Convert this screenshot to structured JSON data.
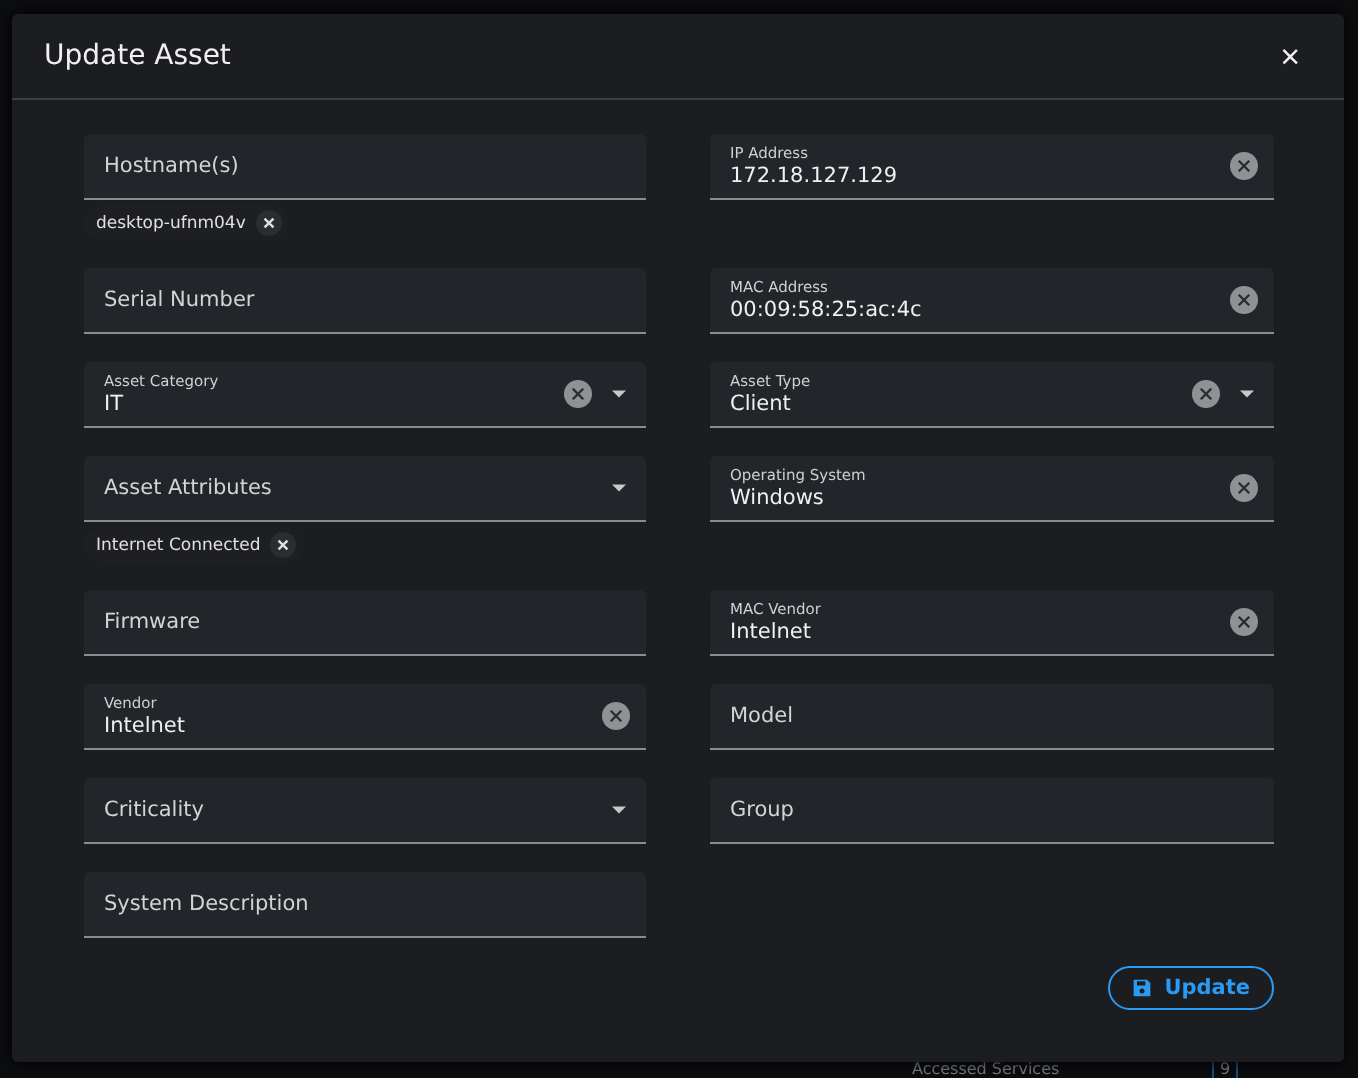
{
  "background": {
    "texts": [
      "Accessed Services",
      "9"
    ]
  },
  "dialog": {
    "title": "Update Asset",
    "close_symbol": "×"
  },
  "rows": [
    {
      "left": {
        "label": "Hostname(s)",
        "clearable": false,
        "dropdown": false,
        "chips": [
          "desktop-ufnm04v"
        ]
      },
      "right": {
        "label": "IP Address",
        "value": "172.18.127.129",
        "clearable": true,
        "dropdown": false
      }
    },
    {
      "left": {
        "label": "Serial Number",
        "clearable": false,
        "dropdown": false
      },
      "right": {
        "label": "MAC Address",
        "value": "00:09:58:25:ac:4c",
        "clearable": true,
        "dropdown": false
      }
    },
    {
      "left": {
        "label": "Asset Category",
        "value": "IT",
        "clearable": true,
        "dropdown": true
      },
      "right": {
        "label": "Asset Type",
        "value": "Client",
        "clearable": true,
        "dropdown": true
      }
    },
    {
      "left": {
        "label": "Asset Attributes",
        "clearable": false,
        "dropdown": true,
        "chips": [
          "Internet Connected"
        ]
      },
      "right": {
        "label": "Operating System",
        "value": "Windows",
        "clearable": true,
        "dropdown": false
      }
    },
    {
      "left": {
        "label": "Firmware",
        "clearable": false,
        "dropdown": false
      },
      "right": {
        "label": "MAC Vendor",
        "value": "Intelnet",
        "clearable": true,
        "dropdown": false
      }
    },
    {
      "left": {
        "label": "Vendor",
        "value": "Intelnet",
        "clearable": true,
        "dropdown": false
      },
      "right": {
        "label": "Model",
        "clearable": false,
        "dropdown": false
      }
    },
    {
      "left": {
        "label": "Criticality",
        "clearable": false,
        "dropdown": true
      },
      "right": {
        "label": "Group",
        "clearable": false,
        "dropdown": false
      }
    },
    {
      "left": {
        "label": "System Description",
        "clearable": false,
        "dropdown": false
      }
    }
  ],
  "submit": {
    "label": "Update"
  }
}
